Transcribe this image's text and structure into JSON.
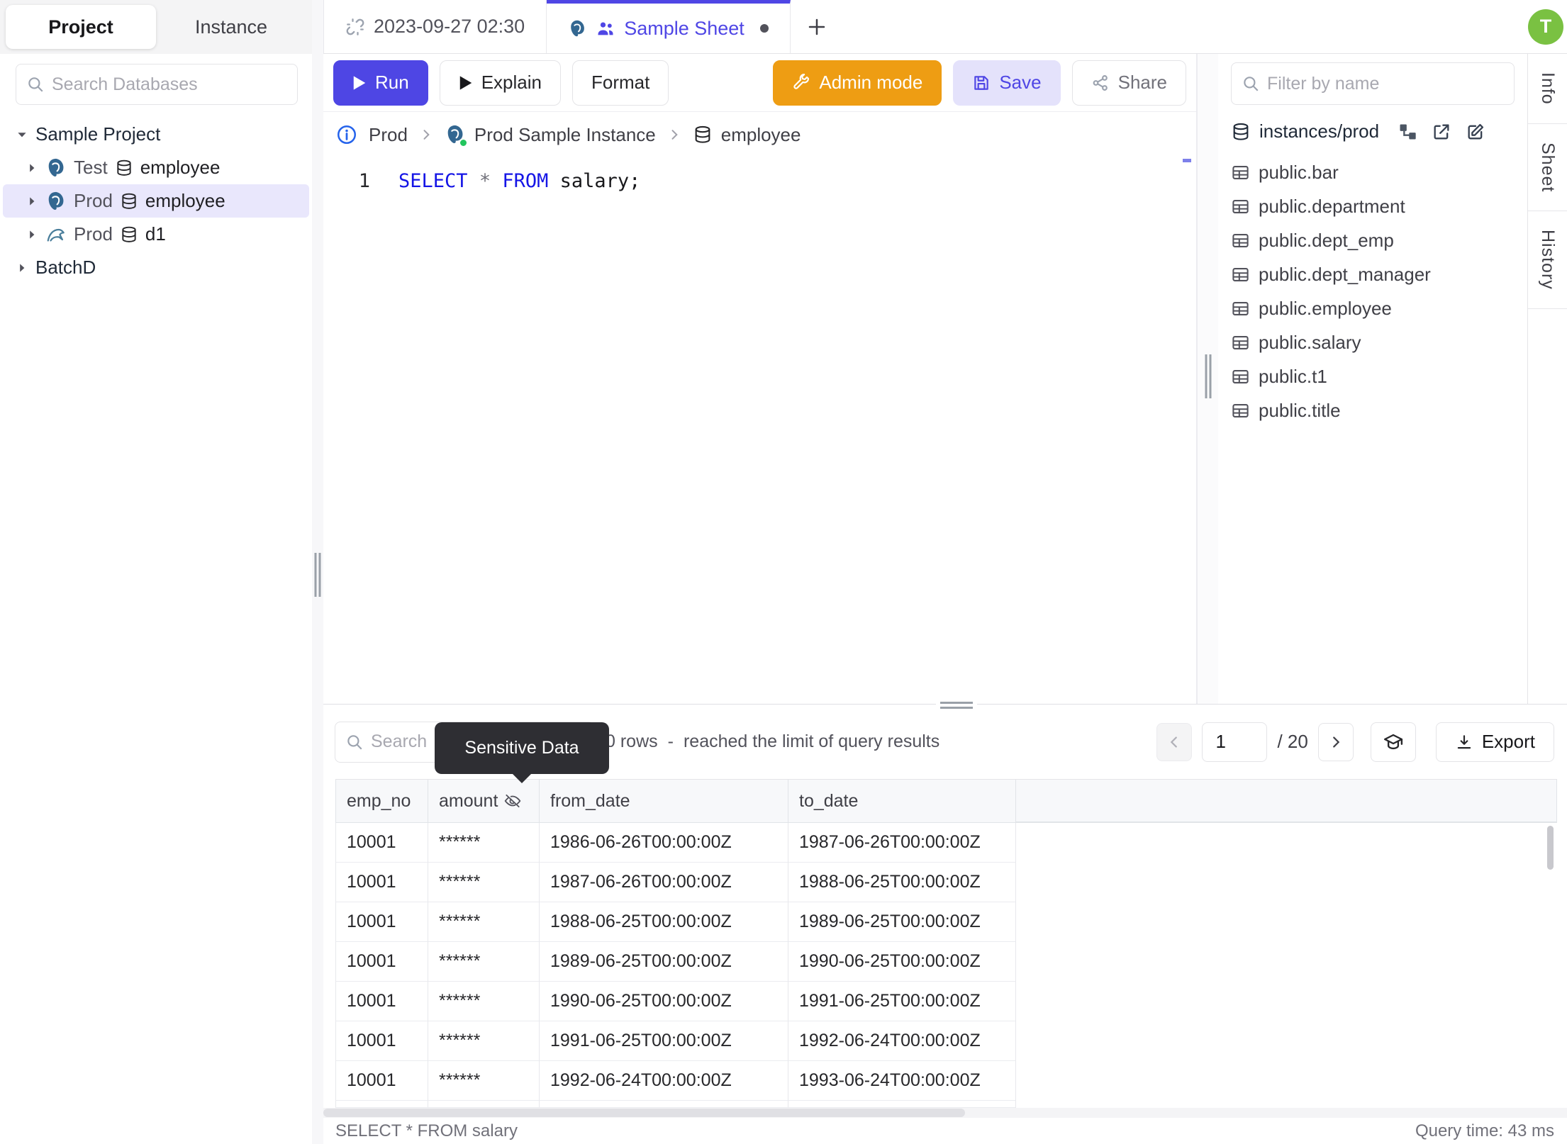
{
  "sidebar": {
    "tabs": {
      "project": "Project",
      "instance": "Instance"
    },
    "search_placeholder": "Search Databases",
    "project_label": "Sample Project",
    "batch_label": "BatchD",
    "items": [
      {
        "env": "Test",
        "db": "employee",
        "engine": "postgres"
      },
      {
        "env": "Prod",
        "db": "employee",
        "engine": "postgres"
      },
      {
        "env": "Prod",
        "db": "d1",
        "engine": "mysql"
      }
    ]
  },
  "tabbar": {
    "tab1": "2023-09-27 02:30",
    "tab2": "Sample Sheet",
    "add": "+"
  },
  "avatar": "T",
  "toolbar": {
    "run": "Run",
    "explain": "Explain",
    "format": "Format",
    "admin": "Admin mode",
    "save": "Save",
    "share": "Share"
  },
  "breadcrumb": {
    "env": "Prod",
    "instance": "Prod Sample Instance",
    "database": "employee"
  },
  "editor": {
    "line_number": "1",
    "kw1": "SELECT",
    "star": "*",
    "kw2": "FROM",
    "tail": " salary;"
  },
  "right_panel": {
    "filter_placeholder": "Filter by name",
    "scope": "instances/prod",
    "tables": [
      "public.bar",
      "public.department",
      "public.dept_emp",
      "public.dept_manager",
      "public.employee",
      "public.salary",
      "public.t1",
      "public.title"
    ]
  },
  "strip": {
    "info": "Info",
    "sheet": "Sheet",
    "history": "History"
  },
  "results": {
    "search_placeholder": "Search",
    "tooltip": "Sensitive Data",
    "rows_count": "0 rows",
    "dash": "-",
    "limit_note": "reached the limit of query results",
    "page": "1",
    "total": "/ 20",
    "export_label": "Export",
    "columns": [
      "emp_no",
      "amount",
      "from_date",
      "to_date"
    ],
    "rows": [
      [
        "10001",
        "******",
        "1986-06-26T00:00:00Z",
        "1987-06-26T00:00:00Z"
      ],
      [
        "10001",
        "******",
        "1987-06-26T00:00:00Z",
        "1988-06-25T00:00:00Z"
      ],
      [
        "10001",
        "******",
        "1988-06-25T00:00:00Z",
        "1989-06-25T00:00:00Z"
      ],
      [
        "10001",
        "******",
        "1989-06-25T00:00:00Z",
        "1990-06-25T00:00:00Z"
      ],
      [
        "10001",
        "******",
        "1990-06-25T00:00:00Z",
        "1991-06-25T00:00:00Z"
      ],
      [
        "10001",
        "******",
        "1991-06-25T00:00:00Z",
        "1992-06-24T00:00:00Z"
      ],
      [
        "10001",
        "******",
        "1992-06-24T00:00:00Z",
        "1993-06-24T00:00:00Z"
      ]
    ],
    "status_sql": "SELECT * FROM salary",
    "status_time": "Query time: 43 ms"
  },
  "colors": {
    "accent": "#4f46e5",
    "admin_orange": "#ee9d13",
    "avatar_green": "#7ac142",
    "keyword_blue": "#1515e6",
    "selected_row": "#e9e7fc"
  }
}
